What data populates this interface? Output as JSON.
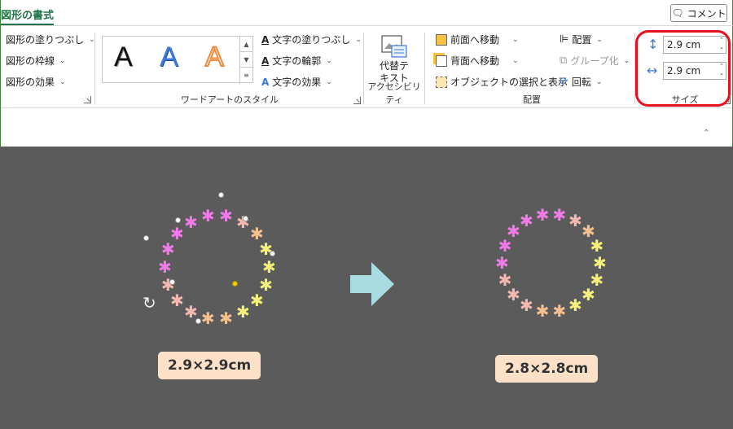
{
  "tabs": {
    "active": "図形の書式",
    "comment": "コメント"
  },
  "shape_styles": {
    "fill": "図形の塗りつぶし",
    "outline": "図形の枠線",
    "effects": "図形の効果"
  },
  "wordart": {
    "samples": [
      "A",
      "A",
      "A"
    ],
    "text_fill": "文字の塗りつぶし",
    "text_outline": "文字の輪郭",
    "text_effects": "文字の効果",
    "group_label": "ワードアートのスタイル"
  },
  "accessibility": {
    "alt_text_line1": "代替テ",
    "alt_text_line2": "キスト",
    "group_label": "アクセシビリティ"
  },
  "arrange": {
    "bring_forward": "前面へ移動",
    "send_backward": "背面へ移動",
    "selection_pane": "オブジェクトの選択と表示",
    "align": "配置",
    "group": "グループ化",
    "rotate": "回転",
    "group_label": "配置"
  },
  "size": {
    "height": "2.9 cm",
    "width": "2.9 cm",
    "group_label": "サイズ"
  },
  "canvas": {
    "before_label": "2.9×2.9cm",
    "after_label": "2.8×2.8cm"
  },
  "colors": {
    "accent": "#217346",
    "highlight": "#e8101e",
    "canvas_bg": "#5b5b5b",
    "arrow": "#a8dce0",
    "pink": "#f07ae8",
    "peach": "#f4b8b0",
    "orange": "#f4c090",
    "yellow": "#f4f07a"
  }
}
